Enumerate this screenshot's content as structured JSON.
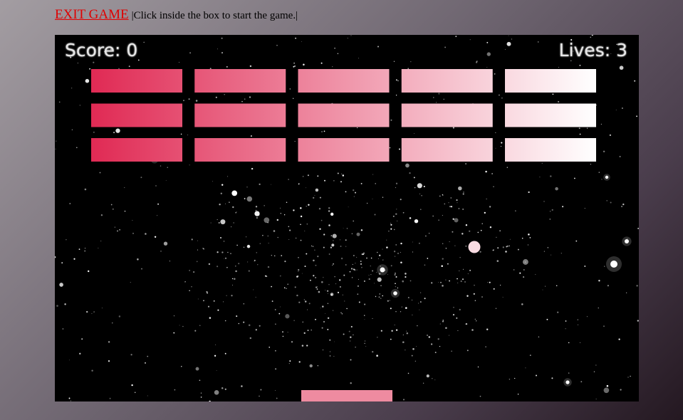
{
  "topbar": {
    "exit_label": "EXIT GAME",
    "hint_text": "|Click inside the box to start the game.|"
  },
  "hud": {
    "score_text": "Score: 0",
    "lives_text": "Lives: 3"
  },
  "game": {
    "brick_rows": 3,
    "brick_columns": 5,
    "bricks_remaining": 15,
    "colors": {
      "background": "#000000",
      "brick_gradient_start": "#e02a54",
      "brick_gradient_end": "#ffffff",
      "paddle": "#ee8ba0",
      "ball": "#f9dbe2",
      "stars": "#ffffff",
      "exit_link": "#e00000"
    }
  }
}
